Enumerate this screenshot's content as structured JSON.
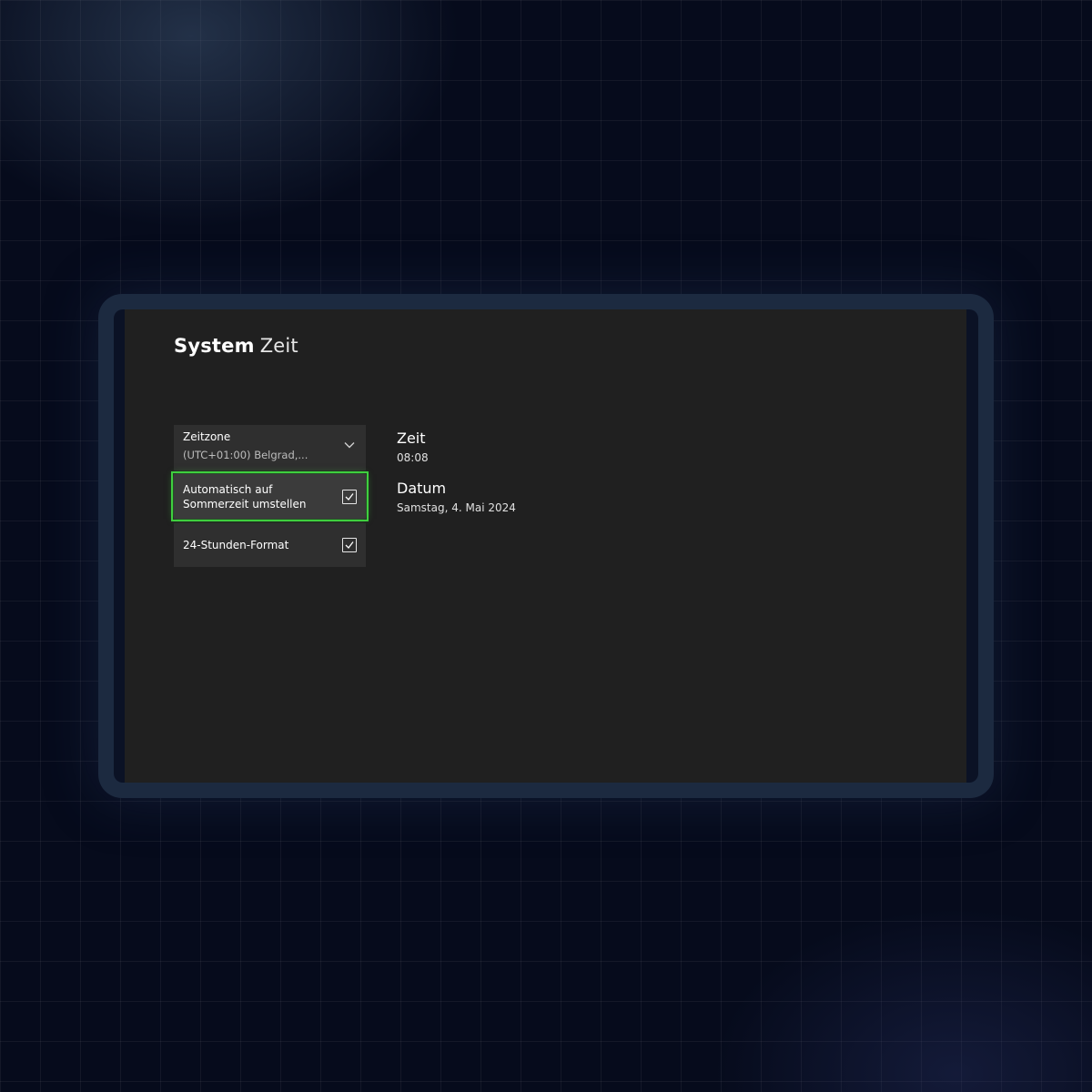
{
  "header": {
    "section": "System",
    "page": "Zeit"
  },
  "settings": {
    "timezone": {
      "label": "Zeitzone",
      "value": "(UTC+01:00) Belgrad,..."
    },
    "dst": {
      "label": "Automatisch auf Sommerzeit umstellen",
      "checked": true
    },
    "format24h": {
      "label": "24-Stunden-Format",
      "checked": true
    }
  },
  "info": {
    "time": {
      "heading": "Zeit",
      "value": "08:08"
    },
    "date": {
      "heading": "Datum",
      "value": "Samstag, 4. Mai 2024"
    }
  },
  "colors": {
    "focus_outline": "#3fcf3f",
    "screen_background": "#202020",
    "control_background": "#2f2f2f",
    "frame": "#1c2a40"
  },
  "icons": {
    "dropdown": "chevron-down-icon",
    "checkbox": "checkmark-icon"
  }
}
